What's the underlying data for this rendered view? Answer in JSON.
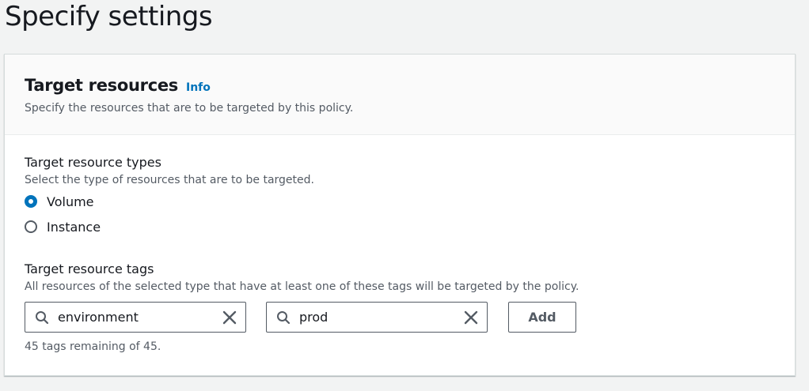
{
  "page": {
    "title": "Specify settings"
  },
  "panel": {
    "title": "Target resources",
    "info_label": "Info",
    "description": "Specify the resources that are to be targeted by this policy."
  },
  "resource_types": {
    "label": "Target resource types",
    "description": "Select the type of resources that are to be targeted.",
    "options": [
      {
        "label": "Volume",
        "selected": true
      },
      {
        "label": "Instance",
        "selected": false
      }
    ]
  },
  "resource_tags": {
    "label": "Target resource tags",
    "description": "All resources of the selected type that have at least one of these tags will be targeted by the policy.",
    "key_value": "environment",
    "value_value": "prod",
    "add_label": "Add",
    "remaining_text": "45 tags remaining of 45."
  },
  "colors": {
    "accent": "#0073bb",
    "text": "#16191f",
    "muted": "#545b64"
  },
  "icons": {
    "search": "search-icon",
    "clear": "close-icon"
  }
}
